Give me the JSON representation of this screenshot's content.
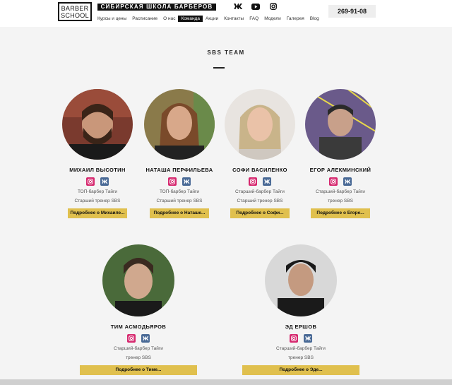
{
  "header": {
    "logo_line1": "BARBER",
    "logo_line2": "SCHOOL",
    "tagline": "СИБИРСКАЯ ШКОЛА БАРБЕРОВ",
    "nav": [
      "Курсы и цены",
      "Расписание",
      "О нас",
      "Команда",
      "Акции",
      "Контакты",
      "FAQ",
      "Модели",
      "Галерея",
      "Blog"
    ],
    "active_nav": "Команда",
    "social_icons": [
      "vk-icon",
      "youtube-icon",
      "instagram-icon"
    ],
    "phone": "269-91-08"
  },
  "section": {
    "title": "SBS TEAM"
  },
  "members": [
    {
      "name": "МИХАИЛ ВЫСОТИН",
      "role1": "ТОП-барбер Тайги",
      "role2": "Старший тренер SBS",
      "button": "Подробнее о Михаиле..."
    },
    {
      "name": "НАТАША ПЕРФИЛЬЕВА",
      "role1": "ТОП-барбер Тайги",
      "role2": "Старший тренер SBS",
      "button": "Подробнее о Наташе..."
    },
    {
      "name": "СОФИ ВАСИЛЕНКО",
      "role1": "Старший-барбер Тайги",
      "role2": "Старший тренер SBS",
      "button": "Подробнее о Софи..."
    },
    {
      "name": "ЕГОР АЛЕКМИНСКИЙ",
      "role1": "Старший-барбер Тайги",
      "role2": "тренер SBS",
      "button": "Подробнее о Егоре..."
    },
    {
      "name": "ТИМ АСМОДЬЯРОВ",
      "role1": "Старший-барбер Тайги",
      "role2": "тренер SBS",
      "button": "Подробнее о Тиме..."
    },
    {
      "name": "ЭД ЕРШОВ",
      "role1": "Старший-барбер Тайги",
      "role2": "тренер SBS",
      "button": "Подробнее о Эде..."
    }
  ],
  "colors": {
    "accent": "#e0c04e",
    "instagram": "#d6296f",
    "vk": "#4a6a96",
    "dark": "#111111"
  }
}
